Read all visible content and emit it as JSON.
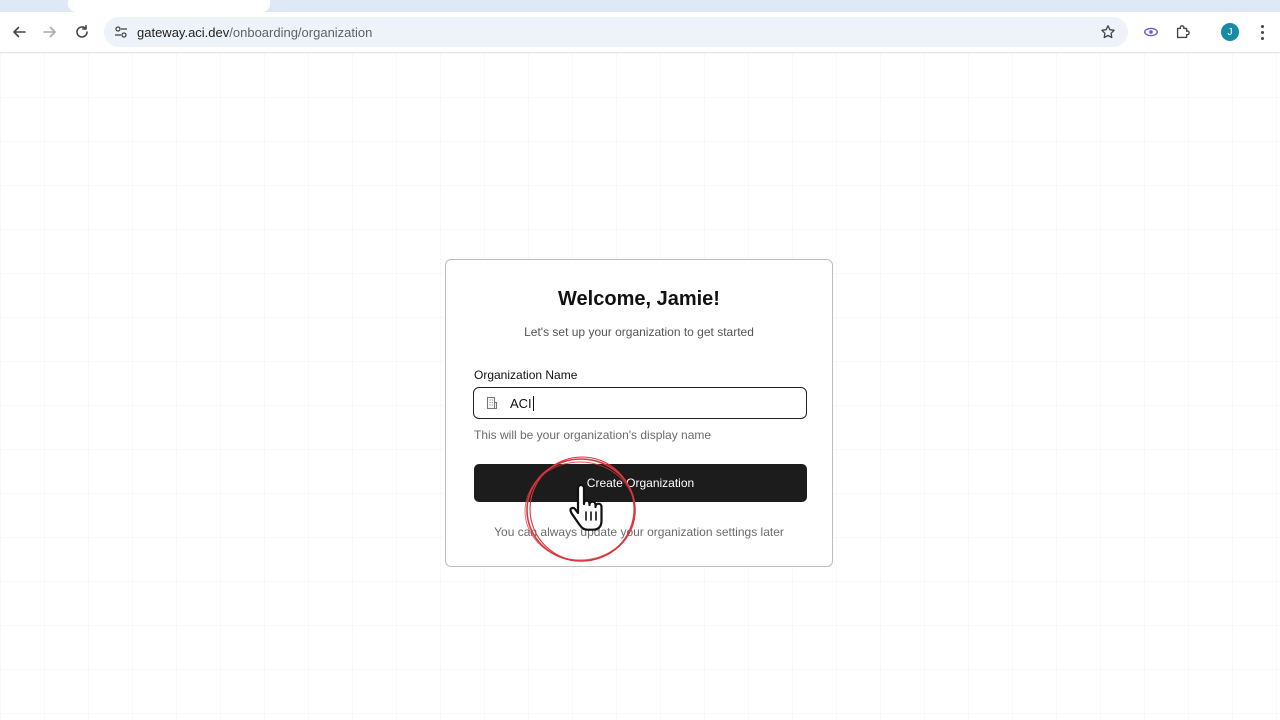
{
  "browser": {
    "url_host": "gateway.aci.dev",
    "url_path": "/onboarding/organization",
    "avatar_initial": "J",
    "accent_color": "#188aa3"
  },
  "card": {
    "title": "Welcome, Jamie!",
    "subtitle": "Let's set up your organization to get started",
    "field_label": "Organization Name",
    "input_value": "ACI",
    "helper_text": "This will be your organization's display name",
    "button_label": "Create Organization",
    "footer_note": "You can always update your organization settings later"
  },
  "icons": {
    "back": "arrow-left-icon",
    "forward": "arrow-right-icon",
    "reload": "reload-icon",
    "site_info": "tune-icon",
    "bookmark": "star-icon",
    "extension_1": "eye-icon",
    "extensions": "puzzle-icon",
    "menu": "kebab-menu-icon",
    "input": "building-icon",
    "click": "hand-pointer-icon"
  },
  "colors": {
    "button_bg": "#1c1c1c",
    "click_ring": "#d9363e"
  }
}
